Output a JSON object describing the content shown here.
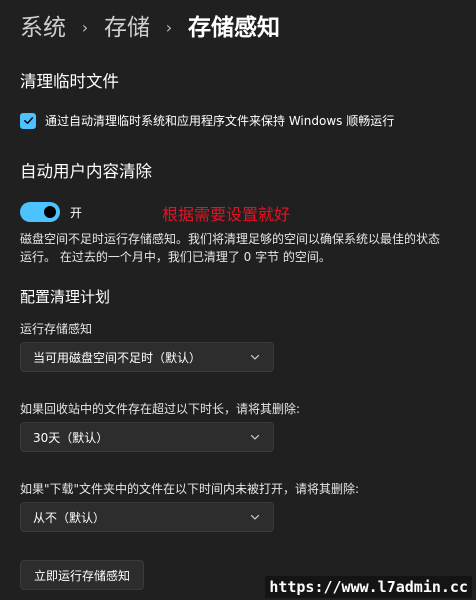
{
  "breadcrumb": {
    "items": [
      "系统",
      "存储",
      "存储感知"
    ],
    "separator": "›"
  },
  "temp_files": {
    "title": "清理临时文件",
    "checkbox_label": "通过自动清理临时系统和应用程序文件来保持 Windows 顺畅运行",
    "checked": true
  },
  "auto_cleanup": {
    "title": "自动用户内容清除",
    "toggle_label": "开",
    "toggle_on": true,
    "description": "磁盘空间不足时运行存储感知。我们将清理足够的空间以确保系统以最佳的状态运行。 在过去的一个月中，我们已清理了 0 字节 的空间。"
  },
  "annotation": "根据需要设置就好",
  "schedule": {
    "title": "配置清理计划",
    "run_label": "运行存储感知",
    "run_value": "当可用磁盘空间不足时（默认）",
    "recycle_label": "如果回收站中的文件存在超过以下时长，请将其删除:",
    "recycle_value": "30天（默认）",
    "downloads_label": "如果\"下载\"文件夹中的文件在以下时间内未被打开，请将其删除:",
    "downloads_value": "从不（默认）"
  },
  "run_now_button": "立即运行存储感知",
  "watermark": "https://www.l7admin.cc",
  "colors": {
    "background": "#202020",
    "accent": "#4cc2ff",
    "annotation": "#e81123"
  }
}
